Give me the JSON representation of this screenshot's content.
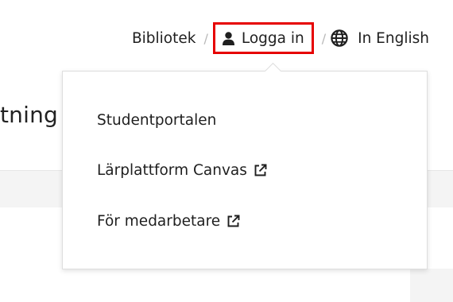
{
  "background": {
    "heading_fragment": "tning"
  },
  "topnav": {
    "library_label": "Bibliotek",
    "separator": "/",
    "login_label": "Logga in",
    "english_label": "In English",
    "login_icon": "user-icon",
    "language_icon": "globe-icon"
  },
  "dropdown": {
    "items": [
      {
        "label": "Studentportalen",
        "external": false
      },
      {
        "label": "Lärplattform Canvas",
        "external": true,
        "icon": "external-link-icon"
      },
      {
        "label": "För medarbetare",
        "external": true,
        "icon": "external-link-icon"
      }
    ]
  },
  "colors": {
    "highlight_border": "#e60000",
    "text": "#1f1f1f",
    "band": "#f4f4f4"
  }
}
